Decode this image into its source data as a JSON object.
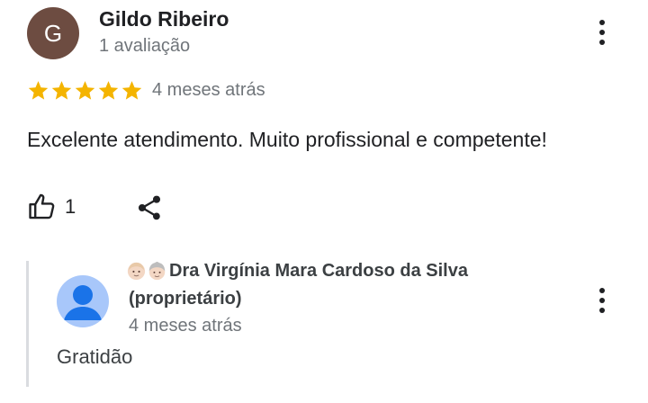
{
  "review": {
    "author_initial": "G",
    "author_name": "Gildo Ribeiro",
    "author_meta": "1 avaliação",
    "rating": 5,
    "rating_max": 5,
    "date": "4 meses atrás",
    "text": "Excelente atendimento. Muito profissional e competente!",
    "like_count": "1",
    "colors": {
      "avatar_bg": "#6d4c41",
      "star": "#f4b400"
    }
  },
  "owner_reply": {
    "owner_name": "Dra Virgínia Mara Cardoso da Silva",
    "owner_role": "(proprietário)",
    "date": "4 meses atrás",
    "text": "Gratidão",
    "colors": {
      "avatar_bg": "#a8c7fa",
      "avatar_figure": "#1a73e8"
    }
  },
  "icons": {
    "more": "more-vert-icon",
    "like": "thumb-up-icon",
    "share": "share-icon",
    "star": "star-icon",
    "person": "person-icon",
    "face_emoji": "person-face-emoji-icon",
    "elder_emoji": "older-woman-emoji-icon"
  }
}
